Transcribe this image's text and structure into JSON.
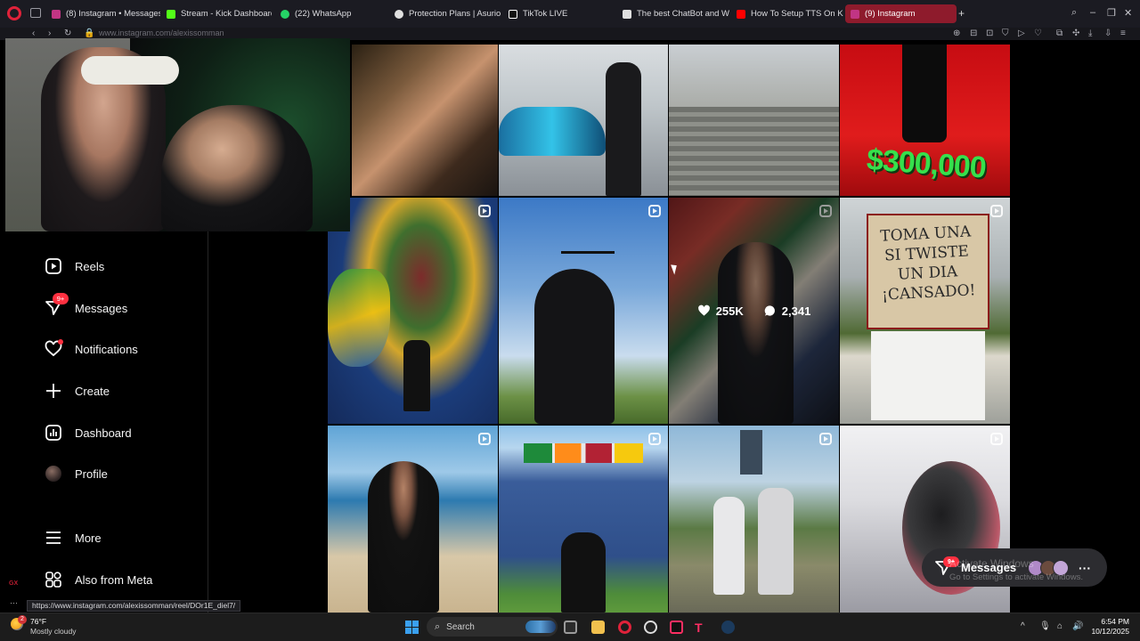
{
  "browser": {
    "tabs": [
      {
        "label": "(8) Instagram • Messages",
        "icon": "instagram-icon",
        "color": "#c13584"
      },
      {
        "label": "Stream - Kick Dashboard",
        "icon": "kick-icon",
        "color": "#53fc18"
      },
      {
        "label": "(22) WhatsApp",
        "icon": "whatsapp-icon",
        "color": "#25d366"
      },
      {
        "label": "Protection Plans | Asurion",
        "icon": "asurion-icon",
        "color": "#e0e0e0"
      },
      {
        "label": "TikTok LIVE",
        "icon": "tiktok-icon",
        "color": "#ffffff"
      },
      {
        "label": "The best ChatBot and W...",
        "icon": "chatbot-icon",
        "color": "#e0e0e0"
      },
      {
        "label": "How To Setup TTS On Ki...",
        "icon": "youtube-icon",
        "color": "#ff0000"
      },
      {
        "label": "(9) Instagram",
        "icon": "instagram-icon",
        "color": "#c13584",
        "active": true
      }
    ],
    "url": "www.instagram.com/alexissomman",
    "accent": "#8e1b2c"
  },
  "sidebar": {
    "items": [
      {
        "label": "Reels",
        "icon": "reels-icon"
      },
      {
        "label": "Messages",
        "icon": "messages-icon",
        "badge": "9+"
      },
      {
        "label": "Notifications",
        "icon": "heart-icon",
        "dot": true
      },
      {
        "label": "Create",
        "icon": "plus-icon"
      },
      {
        "label": "Dashboard",
        "icon": "dashboard-icon"
      },
      {
        "label": "Profile",
        "icon": "avatar"
      },
      {
        "label": "More",
        "icon": "menu-icon"
      },
      {
        "label": "Also from Meta",
        "icon": "meta-icon"
      }
    ],
    "gx_label": "GX"
  },
  "grid": {
    "price_text": "$300,000",
    "sign_text": "TOMA UNA SI TWISTE UN DIA ¡CANSADO!",
    "hover": {
      "likes": "255K",
      "comments": "2,341"
    }
  },
  "messages_float": {
    "label": "Messages",
    "badge": "9+"
  },
  "watermark": {
    "line1": "Activate Windows",
    "line2": "Go to Settings to activate Windows."
  },
  "status_url": "https://www.instagram.com/alexissomman/reel/DOr1E_diel7/",
  "taskbar": {
    "weather_temp": "76°F",
    "weather_desc": "Mostly cloudy",
    "weather_badge": "2",
    "search_placeholder": "Search",
    "time": "6:54 PM",
    "date": "10/12/2025"
  }
}
